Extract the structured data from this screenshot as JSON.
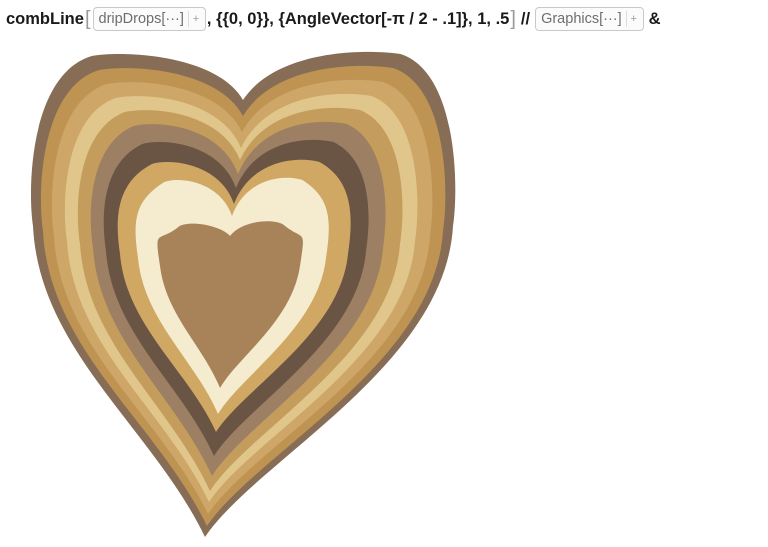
{
  "code": {
    "func": "combLine",
    "chip1_label": "dripDrops[···]",
    "arg_origin": ", {{0, 0}}, {",
    "angle_func": "AngleVector",
    "angle_expr": "[-π / 2 - .1]",
    "tail": "}, 1, .5",
    "op": "//",
    "chip2_label": "Graphics[···]",
    "amp": "&",
    "plus": "+"
  },
  "graphic": {
    "fill_colors_outer_to_inner": [
      "#876d55",
      "#bf9452",
      "#cda668",
      "#e1c68c",
      "#c49d5d",
      "#9d7f63",
      "#6a5443",
      "#d0a864",
      "#f5ebcf",
      "#a88359"
    ]
  }
}
